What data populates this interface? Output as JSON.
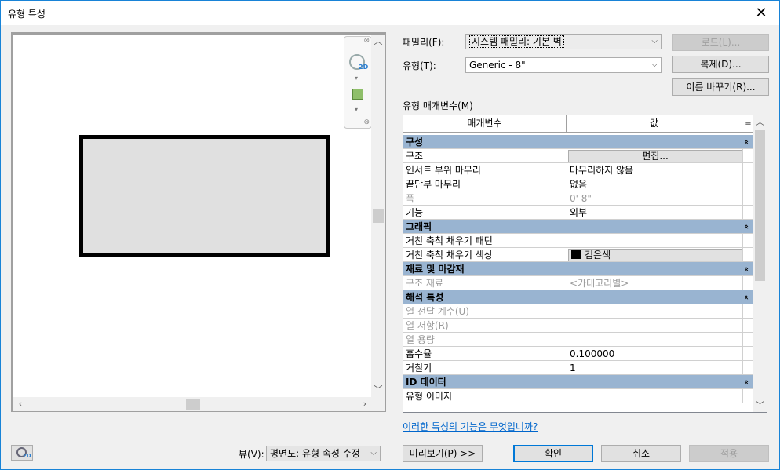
{
  "window": {
    "title": "유형 특성",
    "close_glyph": "✕"
  },
  "preview": {
    "scroll_up": "︿",
    "scroll_down": "﹀",
    "scroll_left": "‹",
    "scroll_right": "›",
    "nav_close": "⊗",
    "nav_2d": "2D",
    "nav_caret": "▾"
  },
  "family": {
    "label": "패밀리(F):",
    "value": "시스템 패밀리: 기본 벽"
  },
  "type": {
    "label": "유형(T):",
    "value": "Generic - 8\""
  },
  "buttons": {
    "load": "로드(L)...",
    "duplicate": "복제(D)...",
    "rename": "이름 바꾸기(R)...",
    "edit": "편집...",
    "preview": "미리보기(P) >>",
    "ok": "확인",
    "cancel": "취소",
    "apply": "적용"
  },
  "params_label": "유형 매개변수(M)",
  "grid": {
    "col_param": "매개변수",
    "col_value": "값",
    "col_eq": "=",
    "collapse": "»",
    "groups": [
      {
        "name": "구성",
        "rows": [
          {
            "param": "구조",
            "value": "편집...",
            "kind": "button"
          },
          {
            "param": "인서트 부위 마무리",
            "value": "마무리하지 않음"
          },
          {
            "param": "끝단부 마무리",
            "value": "없음"
          },
          {
            "param": "폭",
            "value": "0'  8\"",
            "dim": true
          },
          {
            "param": "기능",
            "value": "외부"
          }
        ]
      },
      {
        "name": "그래픽",
        "rows": [
          {
            "param": "거친 축척 채우기 패턴",
            "value": ""
          },
          {
            "param": "거친 축척 채우기 색상",
            "value": "검은색",
            "kind": "color",
            "color": "#000000"
          }
        ]
      },
      {
        "name": "재료 및 마감재",
        "rows": [
          {
            "param": "구조 재료",
            "value": "<카테고리별>",
            "dim": true
          }
        ]
      },
      {
        "name": "해석 특성",
        "rows": [
          {
            "param": "열 전달 계수(U)",
            "value": "",
            "dim": true
          },
          {
            "param": "열 저항(R)",
            "value": "",
            "dim": true
          },
          {
            "param": "열 용량",
            "value": "",
            "dim": true
          },
          {
            "param": "흡수율",
            "value": "0.100000"
          },
          {
            "param": "거칠기",
            "value": "1"
          }
        ]
      },
      {
        "name": "ID 데이터",
        "rows": [
          {
            "param": "유형 이미지",
            "value": ""
          }
        ]
      }
    ]
  },
  "help_link": "이러한 특성의 기능은 무엇입니까?",
  "view": {
    "label": "뷰(V):",
    "value": "평면도: 유형 속성 수정"
  }
}
